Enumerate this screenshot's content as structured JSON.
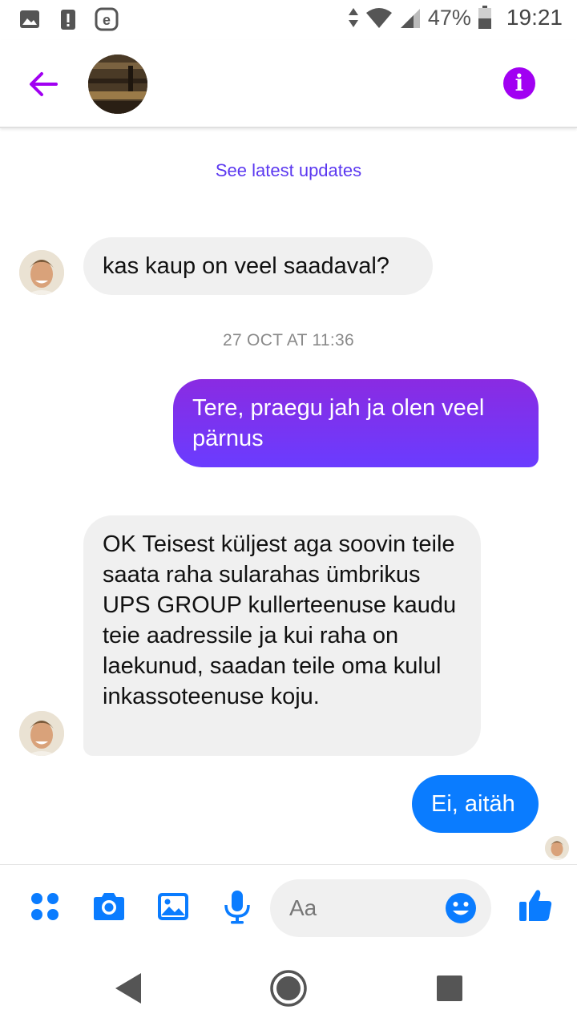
{
  "status_bar": {
    "battery": "47%",
    "time": "19:21",
    "left_icons": [
      "image-icon",
      "alert-icon",
      "e-icon"
    ]
  },
  "header": {
    "back_icon": "arrow-left-icon",
    "info_icon": "info-icon",
    "accent_color": "#a100f2"
  },
  "conversation": {
    "see_latest": "See latest updates",
    "timestamp": "27 OCT AT 11:36",
    "messages": [
      {
        "from": "other",
        "text": "kas kaup on veel saadaval?"
      },
      {
        "from": "me",
        "text": "Tere, praegu jah ja olen veel pärnus"
      },
      {
        "from": "other",
        "text": "OK Teisest küljest aga soovin teile saata raha sularahas ümbrikus UPS GROUP kullerteenuse kaudu teie aadressile ja kui raha on laekunud, saadan teile oma kulul inkassoteenuse koju."
      },
      {
        "from": "me",
        "text": "Ei, aitäh"
      }
    ]
  },
  "composer": {
    "placeholder": "Aa",
    "icons": [
      "more-icon",
      "camera-icon",
      "gallery-icon",
      "microphone-icon",
      "emoji-icon",
      "thumbs-up-icon"
    ],
    "accent_color": "#0a7cff"
  },
  "navigation": {
    "icons": [
      "back-nav-icon",
      "home-nav-icon",
      "recents-nav-icon"
    ]
  }
}
